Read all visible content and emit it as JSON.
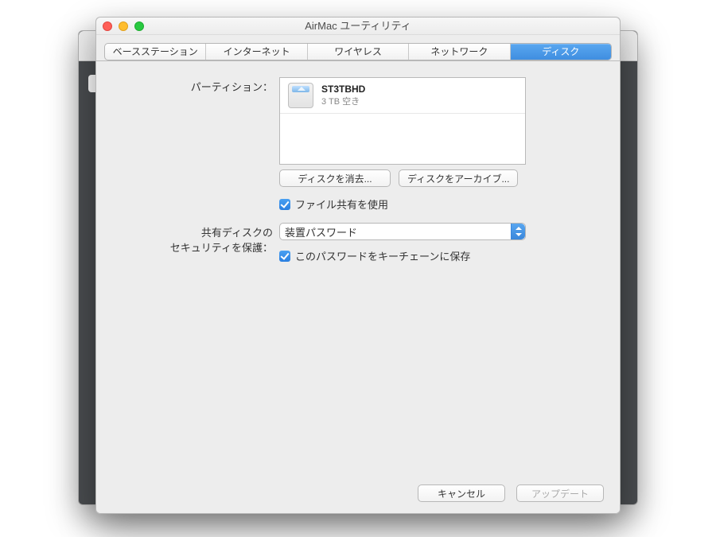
{
  "window": {
    "title": "AirMac ユーティリティ"
  },
  "tabs": [
    {
      "label": "ベースステーション",
      "selected": false
    },
    {
      "label": "インターネット",
      "selected": false
    },
    {
      "label": "ワイヤレス",
      "selected": false
    },
    {
      "label": "ネットワーク",
      "selected": false
    },
    {
      "label": "ディスク",
      "selected": true
    }
  ],
  "labels": {
    "partition": "パーティション：",
    "shared_security_line1": "共有ディスクの",
    "shared_security_line2": "セキュリティを保護："
  },
  "partition": {
    "name": "ST3TBHD",
    "free": "3 TB 空き"
  },
  "buttons": {
    "erase": "ディスクを消去...",
    "archive": "ディスクをアーカイブ...",
    "cancel": "キャンセル",
    "update": "アップデート"
  },
  "checks": {
    "file_sharing": "ファイル共有を使用",
    "keychain": "このパスワードをキーチェーンに保存"
  },
  "security_popup": {
    "value": "装置パスワード"
  }
}
